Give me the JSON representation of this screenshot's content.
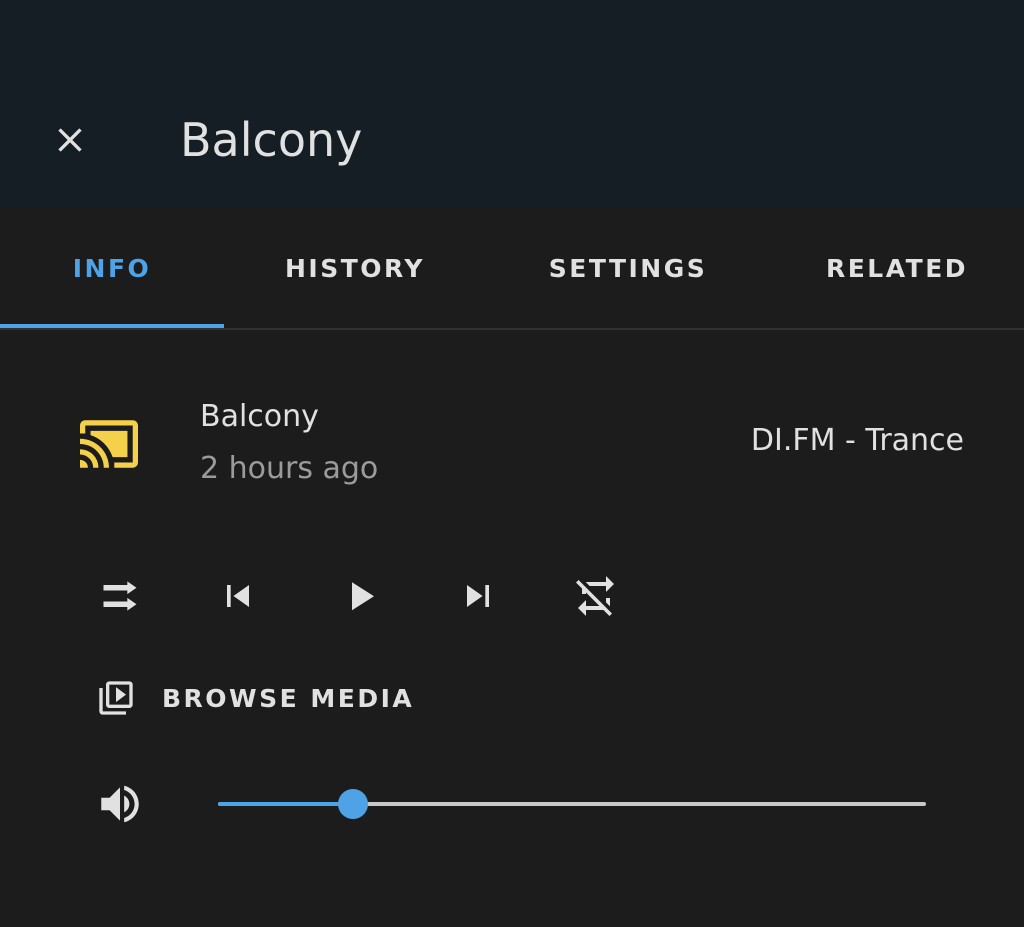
{
  "header": {
    "title": "Balcony",
    "close_icon": "close-icon"
  },
  "tabs": [
    {
      "label": "INFO",
      "active": true
    },
    {
      "label": "HISTORY",
      "active": false
    },
    {
      "label": "SETTINGS",
      "active": false
    },
    {
      "label": "RELATED",
      "active": false
    }
  ],
  "entity": {
    "icon": "cast-connected-icon",
    "name": "Balcony",
    "last_changed": "2 hours ago",
    "media_title": "DI.FM - Trance",
    "icon_color": "#f5d14b"
  },
  "controls": [
    {
      "name": "shuffle-icon"
    },
    {
      "name": "skip-previous-icon"
    },
    {
      "name": "play-icon"
    },
    {
      "name": "skip-next-icon"
    },
    {
      "name": "repeat-off-icon"
    }
  ],
  "browse_media": {
    "label": "BROWSE MEDIA",
    "icon": "play-box-multiple-icon"
  },
  "volume": {
    "icon": "volume-high-icon",
    "level": 0.19
  },
  "colors": {
    "accent": "#4ea3e6",
    "header_bg": "#151e25",
    "body_bg": "#1c1c1c",
    "text": "#e1e1e1",
    "secondary_text": "#9b9b9b"
  }
}
